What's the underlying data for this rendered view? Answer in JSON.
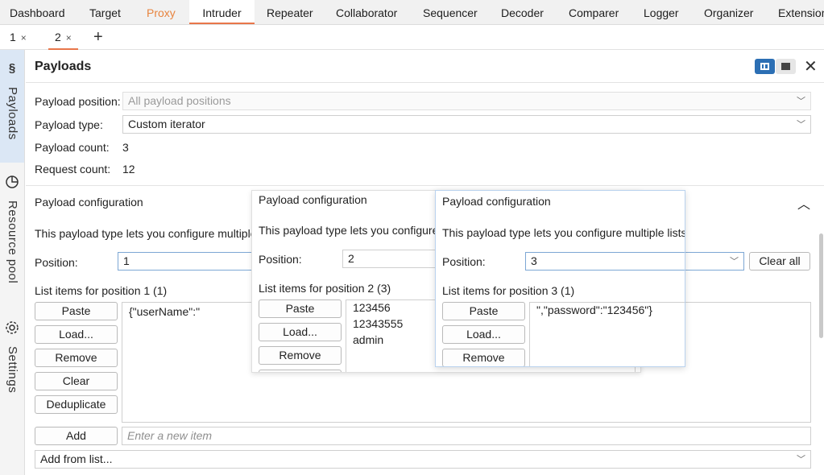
{
  "top_tabs": [
    "Dashboard",
    "Target",
    "Proxy",
    "Intruder",
    "Repeater",
    "Collaborator",
    "Sequencer",
    "Decoder",
    "Comparer",
    "Logger",
    "Organizer",
    "Extensions"
  ],
  "sub_tabs": [
    {
      "label": "1",
      "close": "×"
    },
    {
      "label": "2",
      "close": "×"
    }
  ],
  "sub_tab_add": "+",
  "rail": {
    "payloads": "Payloads",
    "resource_pool": "Resource pool",
    "settings": "Settings"
  },
  "panel": {
    "title": "Payloads",
    "close": "✕",
    "payload_position_label": "Payload position:",
    "payload_position_value": "All payload positions",
    "payload_type_label": "Payload type:",
    "payload_type_value": "Custom iterator",
    "payload_count_label": "Payload count:",
    "payload_count_value": "3",
    "request_count_label": "Request count:",
    "request_count_value": "12"
  },
  "config": {
    "title": "Payload configuration",
    "description": "This payload type lets you configure multiple lists",
    "position_label": "Position:",
    "position_value": "1",
    "clear_all": "Clear all",
    "list_label": "List items for position 1 (1)",
    "buttons": {
      "paste": "Paste",
      "load": "Load...",
      "remove": "Remove",
      "clear": "Clear",
      "deduplicate": "Deduplicate",
      "add": "Add"
    },
    "items": [
      "{\"userName\":\""
    ],
    "new_item_placeholder": "Enter a new item",
    "add_from_list": "Add from list..."
  },
  "overlay_2": {
    "title": "Payload configuration",
    "description": "This payload type lets you configure multiple lists",
    "position_label": "Position:",
    "position_value": "2",
    "list_label": "List items for position 2 (3)",
    "buttons": {
      "paste": "Paste",
      "load": "Load...",
      "remove": "Remove"
    },
    "items": [
      "123456",
      "12343555",
      "admin"
    ]
  },
  "overlay_3": {
    "title": "Payload configuration",
    "description": "This payload type lets you configure multiple lists",
    "position_label": "Position:",
    "position_value": "3",
    "list_label": "List items for position 3 (1)",
    "buttons": {
      "paste": "Paste",
      "load": "Load...",
      "remove": "Remove"
    },
    "items": [
      "\",\"password\":\"123456\"}"
    ]
  },
  "colors": {
    "accent": "#e8764a",
    "proxy": "#e8843e",
    "selected_layout": "#2c6fb4",
    "rail_active": "#dbe7f5"
  }
}
